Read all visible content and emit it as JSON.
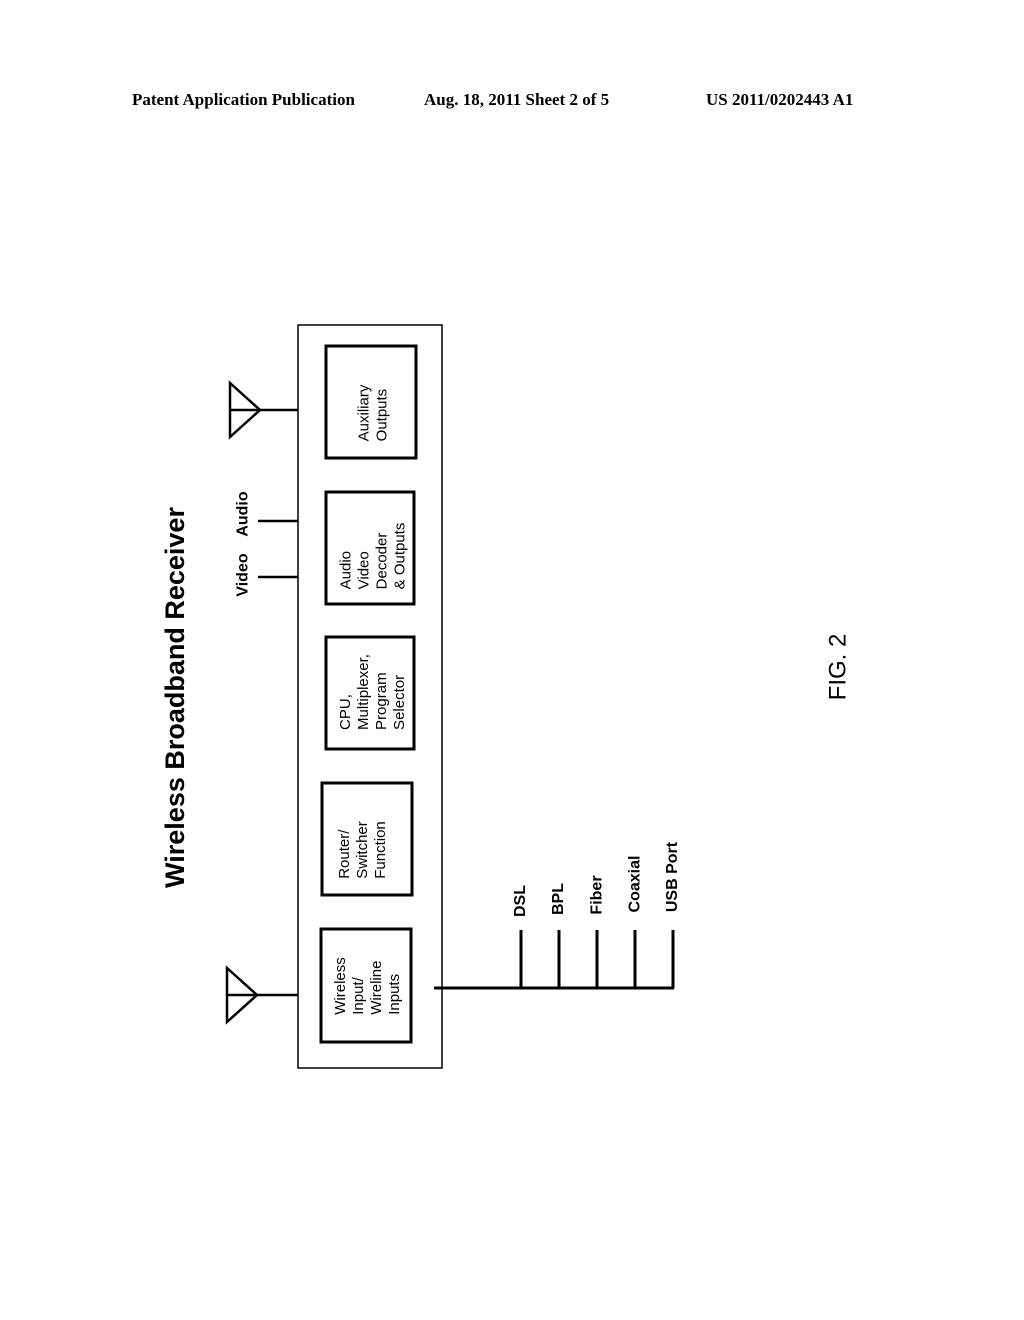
{
  "header": {
    "publication": "Patent Application Publication",
    "date_sheet": "Aug. 18, 2011  Sheet 2 of 5",
    "number": "US 2011/0202443 A1"
  },
  "figure": {
    "title": "Wireless Broadband Receiver",
    "label": "FIG. 2",
    "blocks": [
      {
        "id": "auxiliary",
        "text": "Auxiliary\nOutputs"
      },
      {
        "id": "audio-video",
        "text": "Audio\nVideo\nDecoder\n& Outputs"
      },
      {
        "id": "cpu",
        "text": "CPU,\nMultiplexer,\nProgram\nSelector"
      },
      {
        "id": "router",
        "text": "Router/\nSwitcher\nFunction"
      },
      {
        "id": "wireless-input",
        "text": "Wireless\nInput/\nWireline\nInputs"
      }
    ],
    "outputs": [
      "Video",
      "Audio"
    ],
    "wireline_inputs": [
      "DSL",
      "BPL",
      "Fiber",
      "Coaxial",
      "USB Port"
    ],
    "antennas": [
      "output-antenna",
      "input-antenna"
    ]
  }
}
